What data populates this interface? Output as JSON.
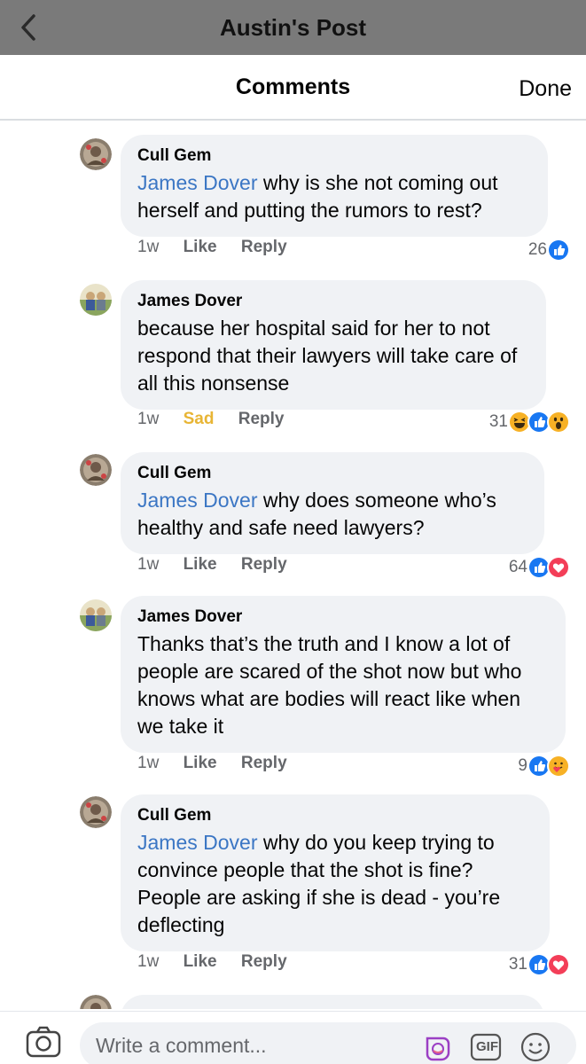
{
  "post_header": {
    "title": "Austin's Post",
    "back_icon": "chevron-left-icon"
  },
  "sheet": {
    "title": "Comments",
    "done_label": "Done"
  },
  "comments": [
    {
      "author": "Cull Gem",
      "mention": "James Dover",
      "text": " why is she not coming out herself and putting the rumors to rest?",
      "time": "1w",
      "like_label": "Like",
      "reply_label": "Reply",
      "reaction_count": "26",
      "reactions": [
        "like-icon"
      ]
    },
    {
      "author": "James Dover",
      "mention": "",
      "text": "because her hospital said for her to not respond that their lawyers will take care of all this nonsense",
      "time": "1w",
      "like_label": "Sad",
      "reply_label": "Reply",
      "reaction_count": "31",
      "reactions": [
        "haha-icon",
        "like-icon",
        "wow-icon"
      ]
    },
    {
      "author": "Cull Gem",
      "mention": "James Dover",
      "text": " why does someone who’s healthy and safe need lawyers?",
      "time": "1w",
      "like_label": "Like",
      "reply_label": "Reply",
      "reaction_count": "64",
      "reactions": [
        "like-icon",
        "love-icon"
      ]
    },
    {
      "author": "James Dover",
      "mention": "",
      "text": "Thanks that’s the truth and I know a lot of people are scared of the shot now but who knows what are bodies will react like when we take it",
      "time": "1w",
      "like_label": "Like",
      "reply_label": "Reply",
      "reaction_count": "9",
      "reactions": [
        "like-icon",
        "care-icon"
      ]
    },
    {
      "author": "Cull Gem",
      "mention": "James Dover",
      "text": " why do you keep trying to convince people that the shot is fine? People are asking if she is dead - you’re deflecting",
      "time": "1w",
      "like_label": "Like",
      "reply_label": "Reply",
      "reaction_count": "31",
      "reactions": [
        "like-icon",
        "love-icon"
      ]
    }
  ],
  "composer": {
    "placeholder": "Write a comment...",
    "icons": [
      "camera-icon",
      "avatar-sticker-icon",
      "gif-icon",
      "emoji-icon"
    ],
    "gif_label": "GIF"
  },
  "colors": {
    "mention": "#3b76c4",
    "sad": "#e8b535",
    "like_blue": "#1877f2",
    "love_red": "#f33e58"
  }
}
